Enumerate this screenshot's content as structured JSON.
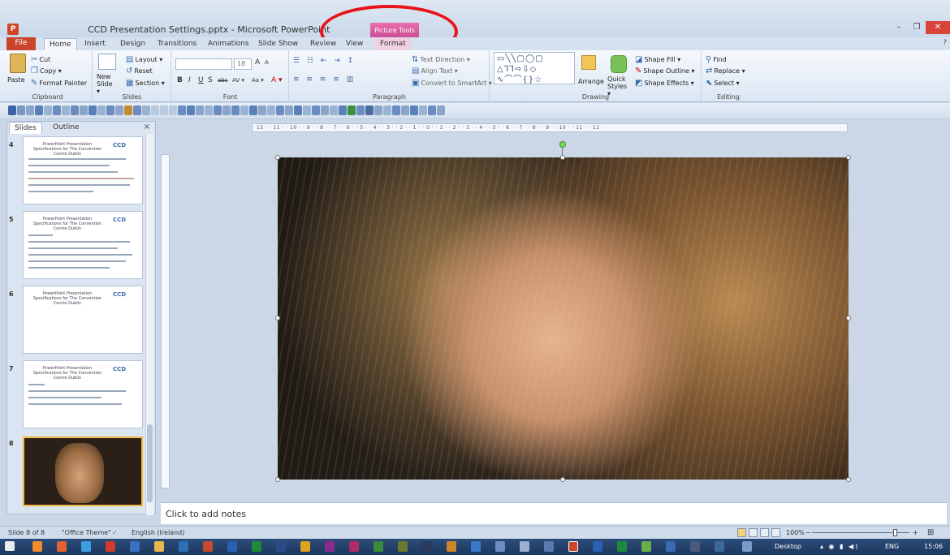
{
  "window": {
    "doc_title": "CCD Presentation Settings.pptx - Microsoft PowerPoint",
    "context_group": "Picture Tools",
    "minimize": "–",
    "restore": "❐",
    "close": "✕",
    "help": "?"
  },
  "tabs": [
    "File",
    "Home",
    "Insert",
    "Design",
    "Transitions",
    "Animations",
    "Slide Show",
    "Review",
    "View",
    "Format"
  ],
  "ribbon": {
    "clipboard": {
      "label": "Clipboard",
      "paste": "Paste",
      "cut": "Cut",
      "copy": "Copy ▾",
      "format_painter": "Format Painter"
    },
    "slides": {
      "label": "Slides",
      "new_slide": "New Slide ▾",
      "layout": "Layout ▾",
      "reset": "Reset",
      "section": "Section ▾"
    },
    "font": {
      "label": "Font",
      "size": "18",
      "bold": "B",
      "italic": "I",
      "underline": "U",
      "shadow": "S",
      "strike": "abc",
      "spacing": "AV ▾",
      "case": "Aa ▾",
      "color": "A ▾",
      "grow": "A",
      "shrink": "A"
    },
    "paragraph": {
      "label": "Paragraph",
      "text_direction": "Text Direction ▾",
      "align_text": "Align Text ▾",
      "smartart": "Convert to SmartArt ▾"
    },
    "drawing": {
      "label": "Drawing",
      "arrange": "Arrange",
      "quick_styles": "Quick Styles ▾",
      "shape_fill": "Shape Fill ▾",
      "shape_outline": "Shape Outline ▾",
      "shape_effects": "Shape Effects ▾",
      "shapes_glyphs": "▭╲╲▢◯▢ △⅂⅂⇨⇩◇ ∿⌒⌒{}☆"
    },
    "editing": {
      "label": "Editing",
      "find": "Find",
      "replace": "Replace ▾",
      "select": "Select ▾"
    }
  },
  "pane": {
    "tabs": [
      "Slides",
      "Outline"
    ],
    "close": "×",
    "slides": [
      {
        "num": "4",
        "title": "PowerPoint Presentation Specifications for The Convention Centre Dublin",
        "logo": "CCD"
      },
      {
        "num": "5",
        "title": "PowerPoint Presentation Specifications for The Convention Centre Dublin",
        "logo": "CCD"
      },
      {
        "num": "6",
        "title": "PowerPoint Presentation Specifications for The Convention Centre Dublin",
        "logo": "CCD"
      },
      {
        "num": "7",
        "title": "PowerPoint Presentation Specifications for The Convention Centre Dublin",
        "logo": "CCD"
      },
      {
        "num": "8"
      }
    ]
  },
  "ruler_h": "· 12 · · 11 · · 10 · · 9 · · 8 · · 7 · · 6 · · 5 · · 4 · · 3 · · 2 · · 1 · · 0 · · 1 · · 2 · · 3 · · 4 · · 5 · · 6 · · 7 · · 8 · · 9 · · 10 · · 11 · · 12 ·",
  "notes_placeholder": "Click to add notes",
  "status": {
    "slide": "Slide 8 of 8",
    "theme": "\"Office Theme\"",
    "language": "English (Ireland)",
    "zoom": "100%",
    "zoom_out": "−",
    "zoom_in": "+"
  },
  "taskbar": {
    "desktop": "Desktop",
    "lang": "ENG",
    "time": "15:06"
  }
}
